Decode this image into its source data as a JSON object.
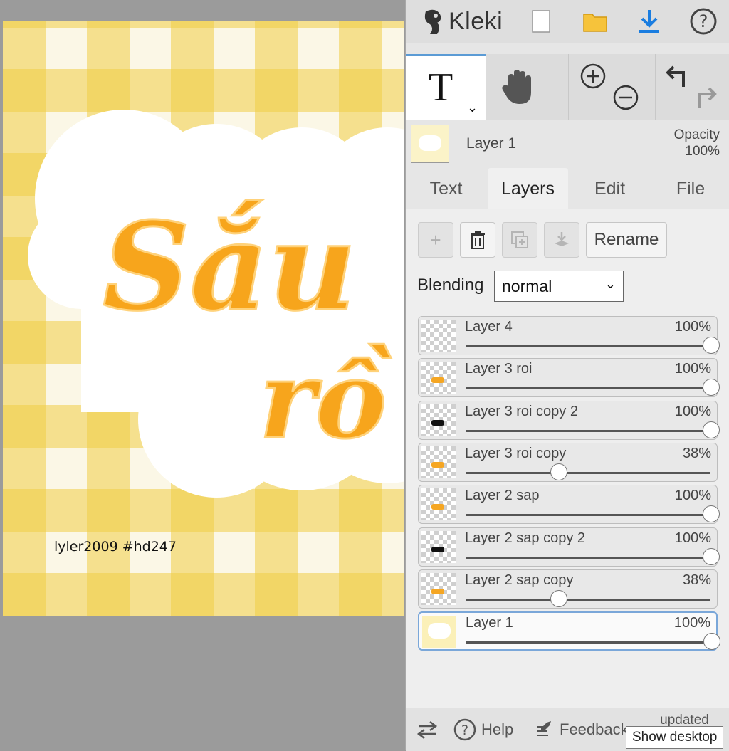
{
  "app": {
    "name": "Kleki"
  },
  "topbar": {
    "icons": [
      "new-image-icon",
      "open-folder-icon",
      "download-icon",
      "help-icon"
    ]
  },
  "tools": {
    "active_tool": "text",
    "zoom_in": "+",
    "zoom_out": "−"
  },
  "current_layer": {
    "name": "Layer 1",
    "opacity_label": "Opacity",
    "opacity_value": "100%"
  },
  "tabs": [
    {
      "label": "Text",
      "active": false
    },
    {
      "label": "Layers",
      "active": true
    },
    {
      "label": "Edit",
      "active": false
    },
    {
      "label": "File",
      "active": false
    }
  ],
  "layer_actions": {
    "rename_label": "Rename"
  },
  "blending": {
    "label": "Blending",
    "value": "normal"
  },
  "layers": [
    {
      "name": "Layer 4",
      "opacity_label": "100%",
      "opacity": 1.0,
      "thumb": "empty",
      "selected": false
    },
    {
      "name": "Layer 3 roi",
      "opacity_label": "100%",
      "opacity": 1.0,
      "thumb": "orange",
      "selected": false
    },
    {
      "name": "Layer 3 roi copy 2",
      "opacity_label": "100%",
      "opacity": 1.0,
      "thumb": "black",
      "selected": false
    },
    {
      "name": "Layer 3 roi copy",
      "opacity_label": "38%",
      "opacity": 0.38,
      "thumb": "orange",
      "selected": false
    },
    {
      "name": "Layer 2 sap",
      "opacity_label": "100%",
      "opacity": 1.0,
      "thumb": "orange",
      "selected": false
    },
    {
      "name": "Layer 2 sap copy 2",
      "opacity_label": "100%",
      "opacity": 1.0,
      "thumb": "black",
      "selected": false
    },
    {
      "name": "Layer 2 sap copy",
      "opacity_label": "38%",
      "opacity": 0.38,
      "thumb": "orange",
      "selected": false
    },
    {
      "name": "Layer 1",
      "opacity_label": "100%",
      "opacity": 1.0,
      "thumb": "background",
      "selected": true
    }
  ],
  "canvas": {
    "signature": "lyler2009   #hd247"
  },
  "bottombar": {
    "help_label": "Help",
    "feedback_label": "Feedback",
    "updated_label": "updated"
  },
  "tooltip": {
    "text": "Show desktop"
  },
  "colors": {
    "accent": "#5b9bd5",
    "orange_text": "#f5a623",
    "plaid_yellow": "#f0ce46",
    "panel_bg": "#e6e6e6"
  }
}
